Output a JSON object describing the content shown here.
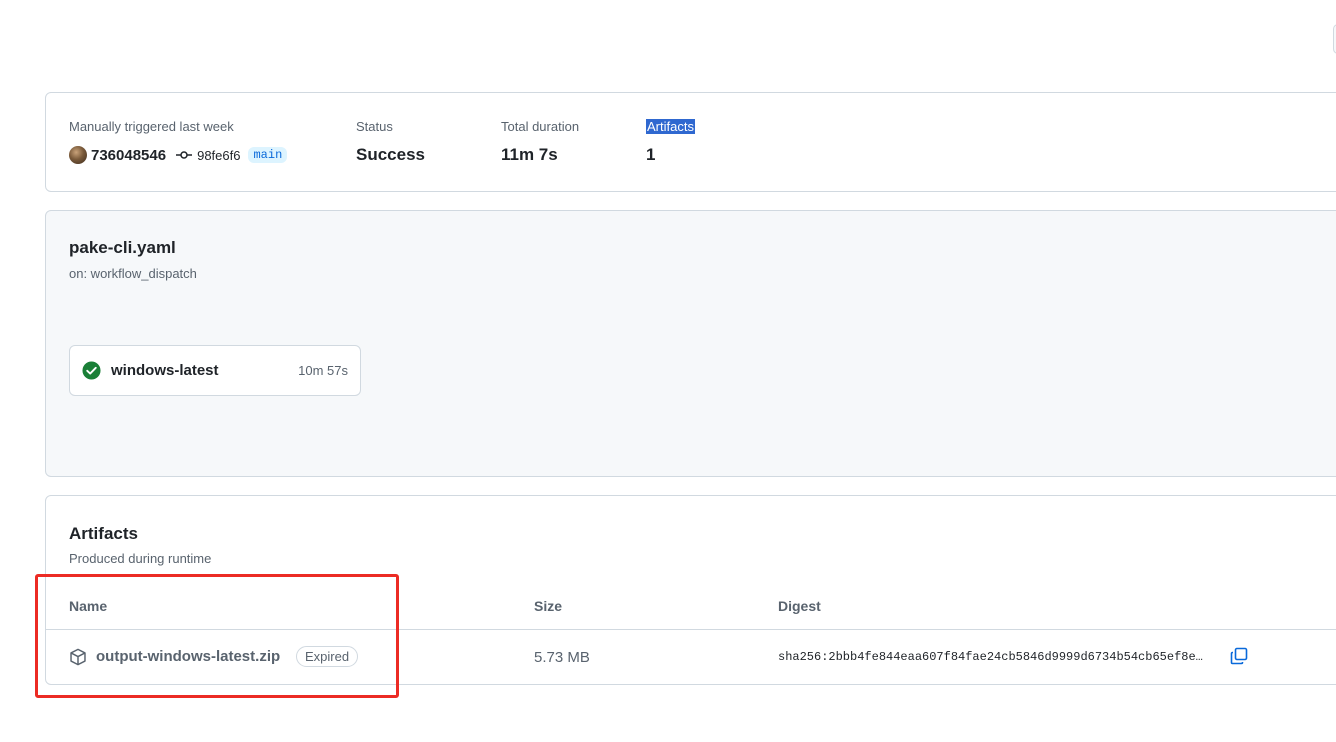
{
  "summary": {
    "trigger_label": "Manually triggered last week",
    "actor": "736048546",
    "commit_sha": "98fe6f6",
    "branch": "main",
    "status_label": "Status",
    "status_value": "Success",
    "duration_label": "Total duration",
    "duration_value": "11m 7s",
    "artifacts_label": "Artifacts",
    "artifacts_value": "1"
  },
  "workflow": {
    "file": "pake-cli.yaml",
    "trigger": "on: workflow_dispatch",
    "jobs": [
      {
        "name": "windows-latest",
        "duration": "10m 57s",
        "status": "success"
      }
    ]
  },
  "artifacts": {
    "title": "Artifacts",
    "subtitle": "Produced during runtime",
    "columns": [
      "Name",
      "Size",
      "Digest"
    ],
    "rows": [
      {
        "name": "output-windows-latest.zip",
        "badge": "Expired",
        "size": "5.73 MB",
        "digest": "sha256:2bbb4fe844eaa607f84fae24cb5846d9999d6734b54cb65ef8e…"
      }
    ]
  },
  "colors": {
    "accent": "#0969da",
    "success": "#1a7f37",
    "highlight": "#ec2b24",
    "selection": "#2f68d0"
  }
}
